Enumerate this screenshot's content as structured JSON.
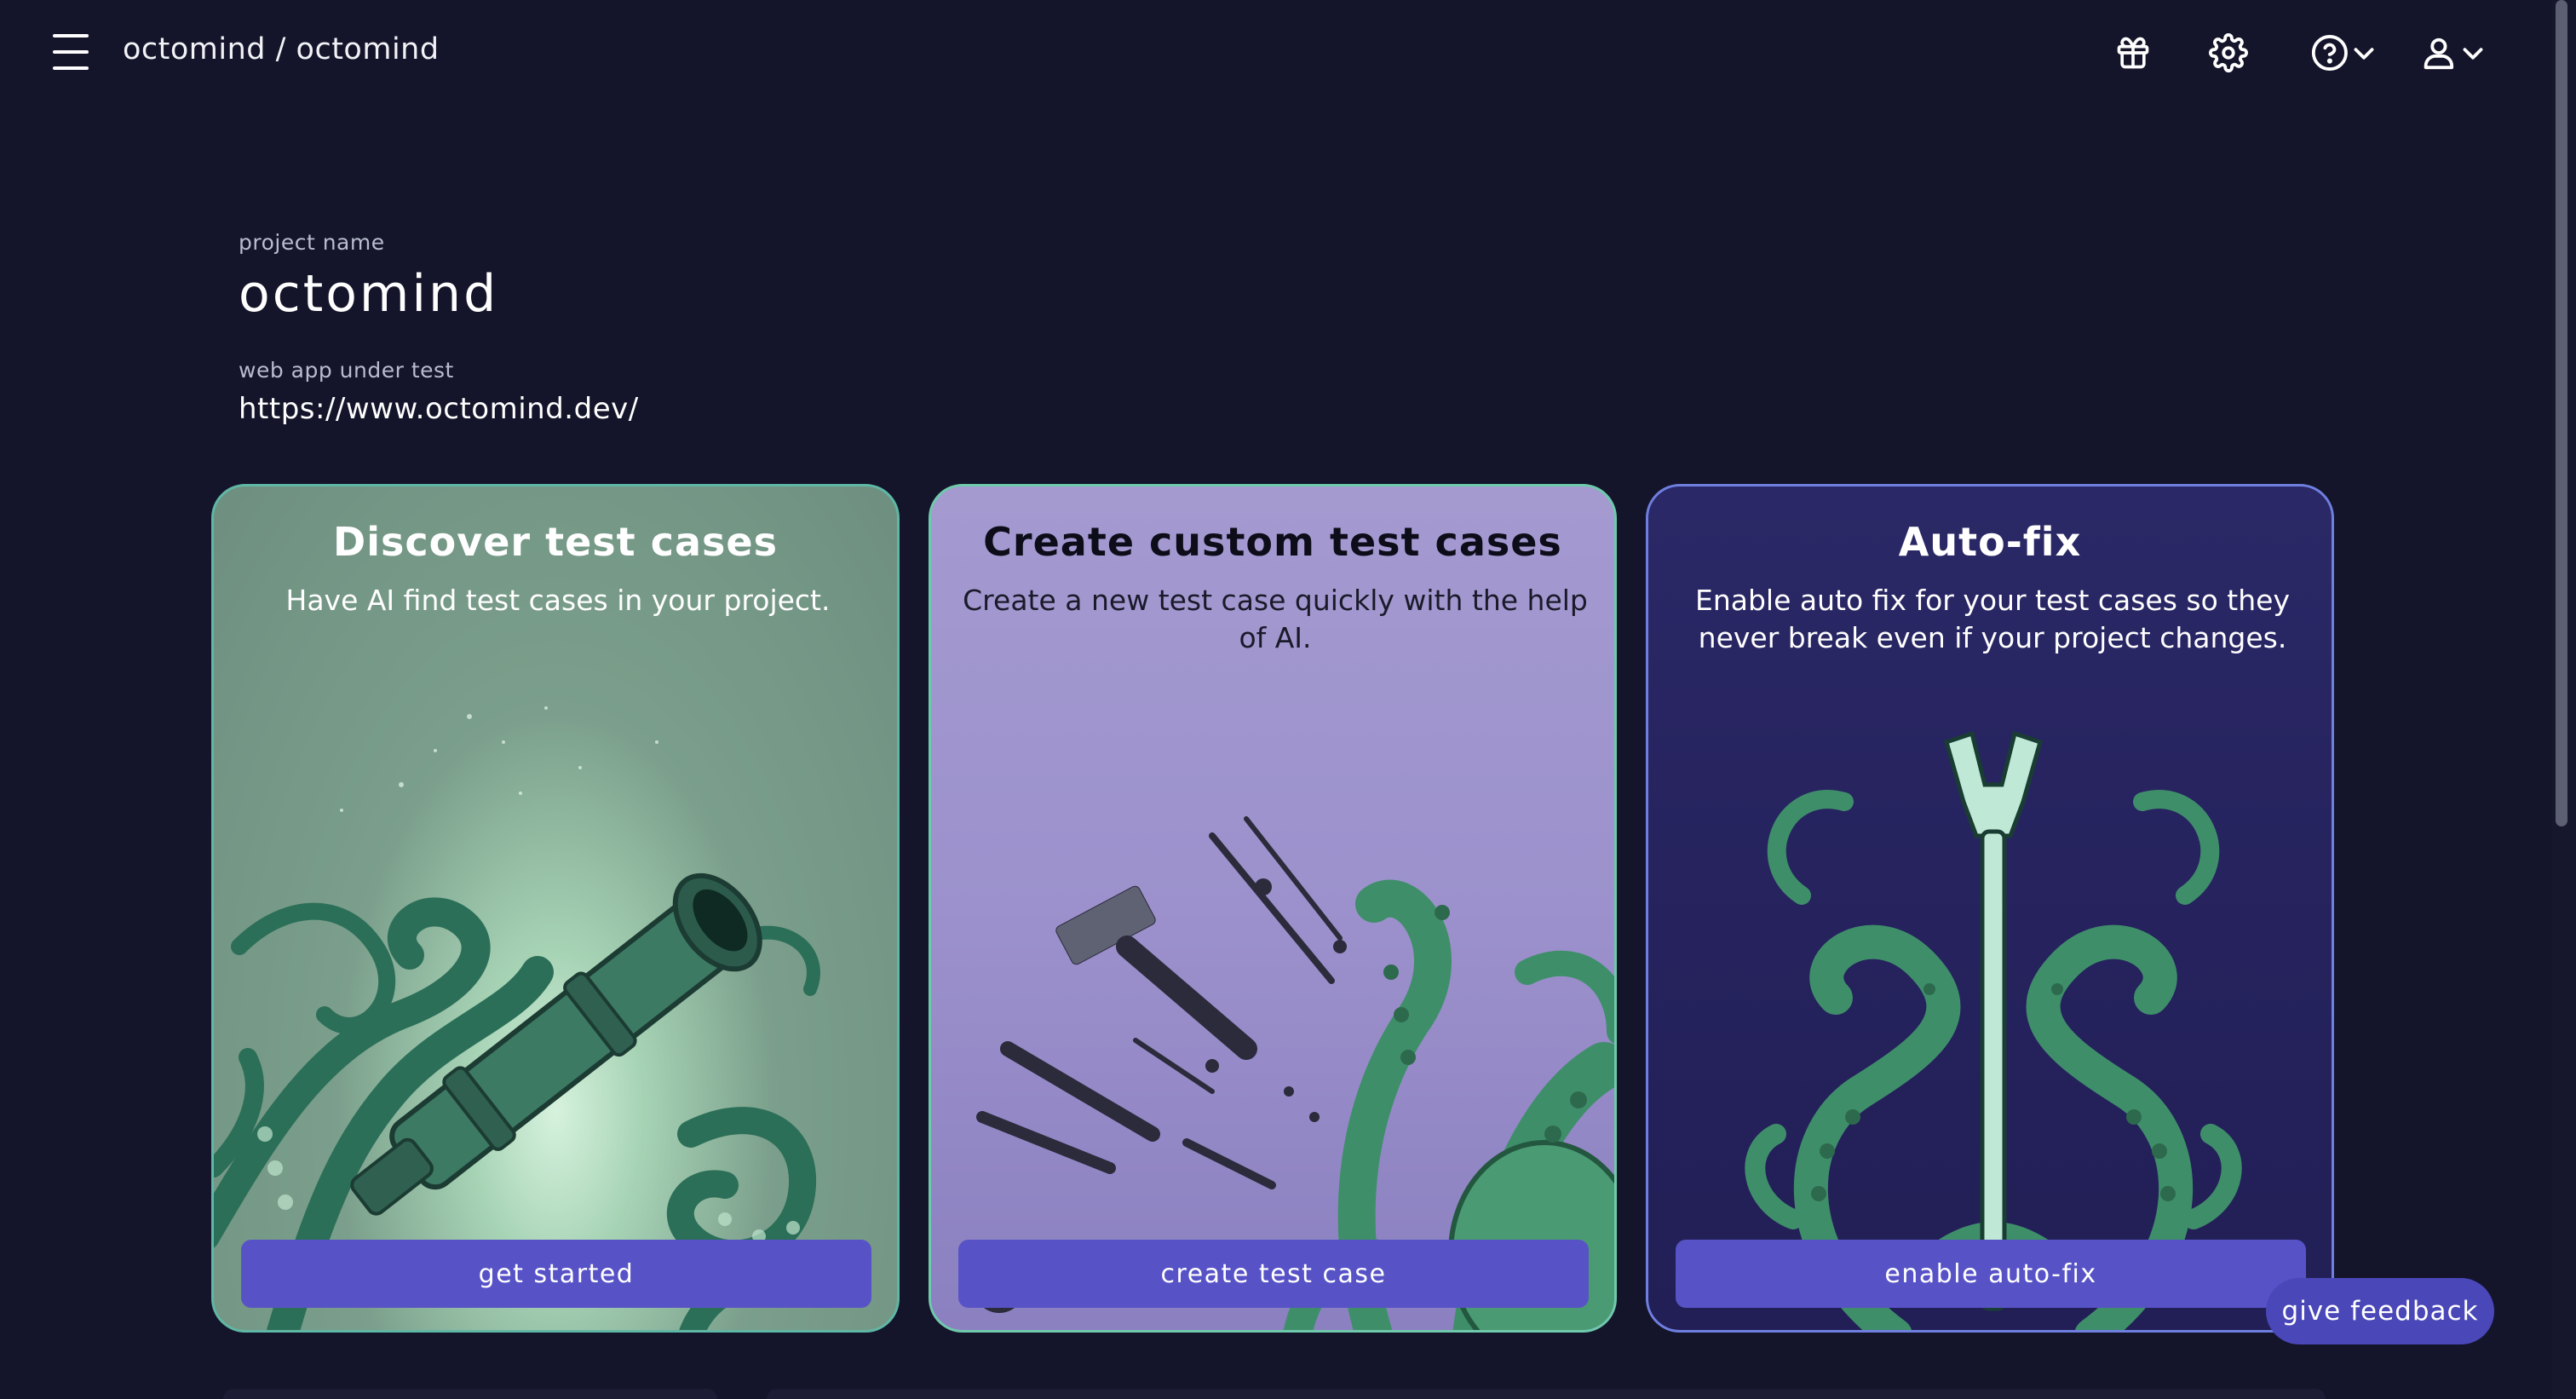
{
  "header": {
    "breadcrumb": "octomind / octomind",
    "icons": [
      "menu-icon",
      "gift-icon",
      "gear-icon",
      "help-circle-icon",
      "user-icon"
    ]
  },
  "project": {
    "name_label": "project name",
    "name": "octomind",
    "url_label": "web app under test",
    "url": "https://www.octomind.dev/"
  },
  "cards": [
    {
      "title": "Discover test cases",
      "description": "Have AI find test cases in your project.",
      "button": "get started",
      "illustration": "octopus-telescope"
    },
    {
      "title": "Create custom test cases",
      "description": "Create a new test case quickly with the help of AI.",
      "button": "create test case",
      "illustration": "octopus-tools"
    },
    {
      "title": "Auto-fix",
      "description": "Enable auto fix for your test cases so they never break even if your project changes.",
      "button": "enable auto-fix",
      "illustration": "octopus-wrench"
    }
  ],
  "feedback": {
    "label": "give feedback"
  },
  "colors": {
    "background": "#14152a",
    "accent_button": "#5753c7",
    "feedback_button": "#4a47b8",
    "card1_bg": "#7b9f8c",
    "card2_bg": "#9c91cc",
    "card3_bg": "#25225d",
    "tentacle_green": "#3f8e6a"
  }
}
